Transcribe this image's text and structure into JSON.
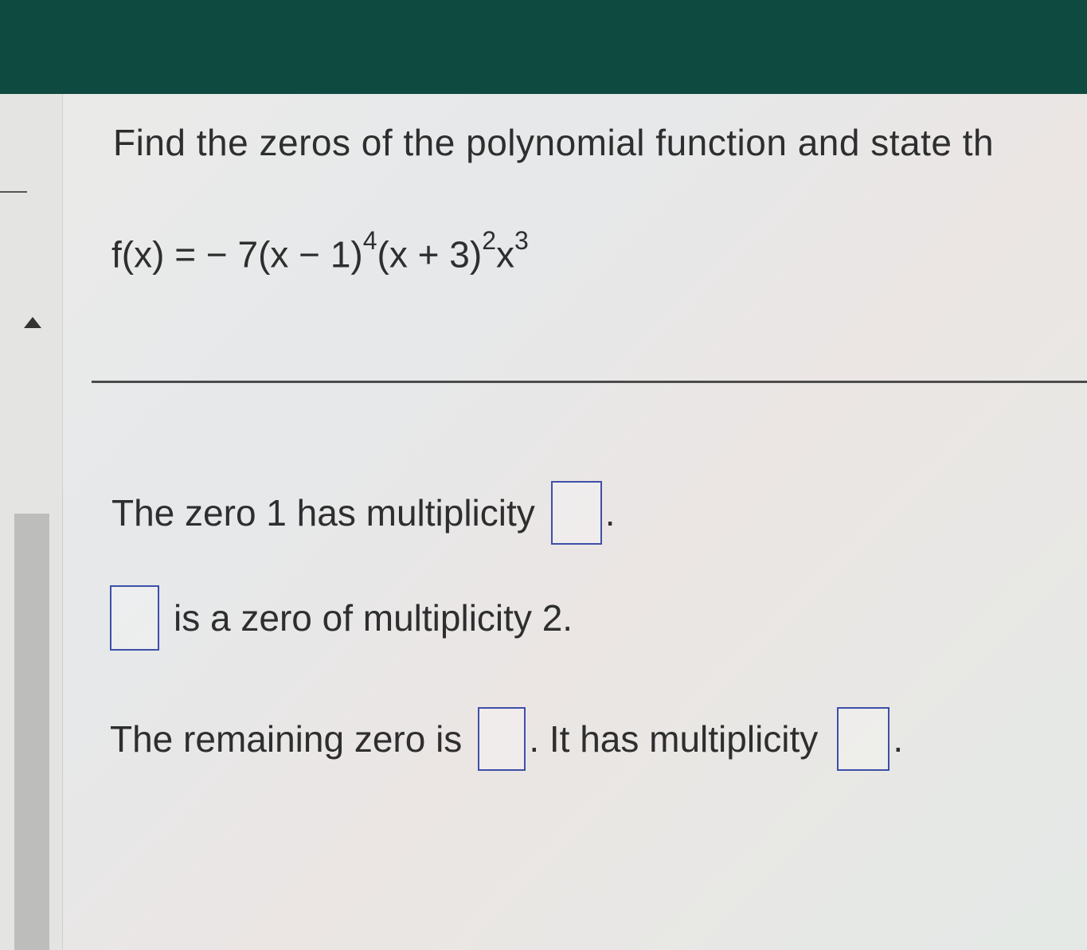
{
  "colors": {
    "header_bar": "#0f4a40",
    "answer_box_border": "#3e4fa8"
  },
  "question": {
    "prompt": "Find the zeros of the polynomial function and state th",
    "equation": {
      "lhs": "f(x) = ",
      "coefficient": "− 7",
      "factor1": "(x − 1)",
      "exp1": "4",
      "factor2": "(x + 3)",
      "exp2": "2",
      "factor3": "x",
      "exp3": "3"
    }
  },
  "answers": {
    "line1": {
      "text": "The zero 1 has multiplicity",
      "suffix": ".",
      "value": ""
    },
    "line2": {
      "value": "",
      "text": "is a zero of multiplicity 2."
    },
    "line3": {
      "text": "The remaining zero is",
      "value1": "",
      "middle": ". It has multiplicity",
      "value2": "",
      "suffix": "."
    }
  }
}
